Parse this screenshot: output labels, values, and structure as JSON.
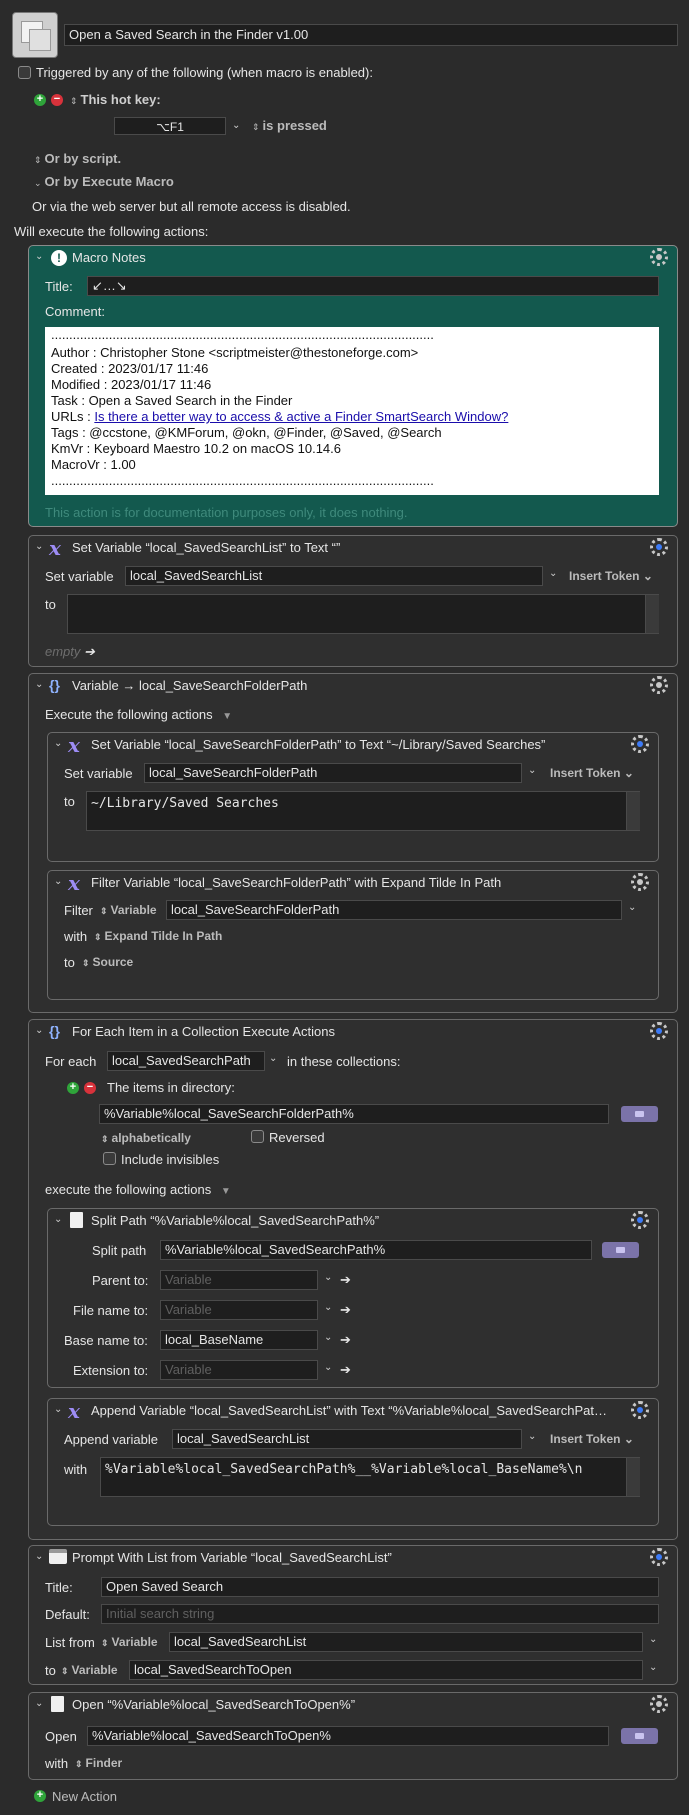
{
  "macro": {
    "name": "Open a Saved Search in the Finder v1.00",
    "triggered_label": "Triggered by any of the following (when macro is enabled):",
    "hotkey_label": "This hot key:",
    "hotkey_value": "⌥F1",
    "is_pressed": "is pressed",
    "or_by_script": "Or by script.",
    "or_by_execute_macro": "Or by Execute Macro",
    "web_server_text": "Or via the web server but all remote access is disabled.",
    "will_execute": "Will execute the following actions:"
  },
  "notes": {
    "header": "Macro Notes",
    "title_label": "Title:",
    "title_value": "↙…↘",
    "comment_label": "Comment:",
    "dots": "..........................................................................................................",
    "lines": [
      "Author    : Christopher Stone <scriptmeister@thestoneforge.com>",
      "Created   :  2023/01/17 11:46",
      "Modified  :  2023/01/17 11:46",
      "Task        :  Open a Saved Search in the Finder",
      "URLs       :  ",
      "Tags        :  @ccstone, @KMForum, @okn, @Finder, @Saved, @Search",
      "KmVr       :  Keyboard Maestro 10.2 on macOS 10.14.6",
      "MacroVr  :  1.00"
    ],
    "url_text": "Is there a better way to access & active a Finder SmartSearch Window?",
    "footer": "This action is for documentation purposes only, it does nothing."
  },
  "setvar1": {
    "header": "Set Variable “local_SavedSearchList” to Text “”",
    "set_variable_label": "Set variable",
    "variable": "local_SavedSearchList",
    "insert_token": "Insert Token",
    "to_label": "to",
    "empty": "empty"
  },
  "group": {
    "header": "Variable → local_SaveSearchFolderPath",
    "execute_label": "Execute the following actions",
    "setvar": {
      "header": "Set Variable “local_SaveSearchFolderPath” to Text “~/Library/Saved Searches”",
      "set_variable_label": "Set variable",
      "variable": "local_SaveSearchFolderPath",
      "insert_token": "Insert Token",
      "to_label": "to",
      "value": "~/Library/Saved Searches"
    },
    "filter": {
      "header": "Filter Variable “local_SaveSearchFolderPath” with Expand Tilde In Path",
      "filter_label": "Filter",
      "variable_kind": "Variable",
      "variable": "local_SaveSearchFolderPath",
      "with_label": "with",
      "with_value": "Expand Tilde In Path",
      "to_label": "to",
      "to_value": "Source"
    }
  },
  "foreach": {
    "header": "For Each Item in a Collection Execute Actions",
    "for_each_label": "For each",
    "variable": "local_SavedSearchPath",
    "in_collections": "in these collections:",
    "items_in_dir": "The items in directory:",
    "dir_value": "%Variable%local_SaveSearchFolderPath%",
    "alphabetically": "alphabetically",
    "reversed": "Reversed",
    "include_invisibles": "Include invisibles",
    "execute_label": "execute the following actions",
    "split": {
      "header": "Split Path “%Variable%local_SavedSearchPath%”",
      "split_path_label": "Split path",
      "split_path_value": "%Variable%local_SavedSearchPath%",
      "parent_label": "Parent to:",
      "file_name_label": "File name to:",
      "base_name_label": "Base name to:",
      "extension_label": "Extension to:",
      "placeholder": "Variable",
      "base_name_value": "local_BaseName"
    },
    "append": {
      "header": "Append Variable “local_SavedSearchList” with Text “%Variable%local_SavedSearchPat…",
      "append_label": "Append variable",
      "variable": "local_SavedSearchList",
      "insert_token": "Insert Token",
      "with_label": "with",
      "value": "%Variable%local_SavedSearchPath%__%Variable%local_BaseName%\\n"
    }
  },
  "prompt": {
    "header": "Prompt With List from Variable “local_SavedSearchList”",
    "title_label": "Title:",
    "title_value": "Open Saved Search",
    "default_label": "Default:",
    "default_placeholder": "Initial search string",
    "list_from_label": "List from",
    "variable_kind": "Variable",
    "list_from_value": "local_SavedSearchList",
    "to_label": "to",
    "to_value": "local_SavedSearchToOpen"
  },
  "open": {
    "header": "Open “%Variable%local_SavedSearchToOpen%”",
    "open_label": "Open",
    "open_value": "%Variable%local_SavedSearchToOpen%",
    "with_label": "with",
    "with_value": "Finder"
  },
  "new_action": "New Action"
}
